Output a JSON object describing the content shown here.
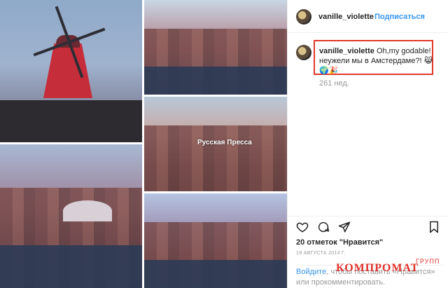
{
  "header": {
    "username": "vanille_violette",
    "follow_label": "Подписаться"
  },
  "comment": {
    "username": "vanille_violette",
    "text": "Oh,my godable! неужели мы в Амстердаме?! 😹🌍🎉",
    "time_ago": "261 нед."
  },
  "collage": {
    "watermark": "Русская Пресса"
  },
  "actions": {
    "like_icon": "heart-icon",
    "comment_icon": "speech-bubble-icon",
    "share_icon": "paper-plane-icon",
    "save_icon": "bookmark-icon"
  },
  "likes_label": "20 отметок \"Нравится\"",
  "date": "19 АВГУСТА 2014 Г.",
  "login_note": {
    "link": "Войдите",
    "rest": ", чтобы поставить «Нравится» или прокомментировать."
  },
  "overlay": {
    "brand": "КОМПРОМАТ",
    "brand_sub": "ГРУПП"
  },
  "colors": {
    "accent": "#3897f0",
    "highlight": "#e1382b",
    "muted": "#999999"
  }
}
